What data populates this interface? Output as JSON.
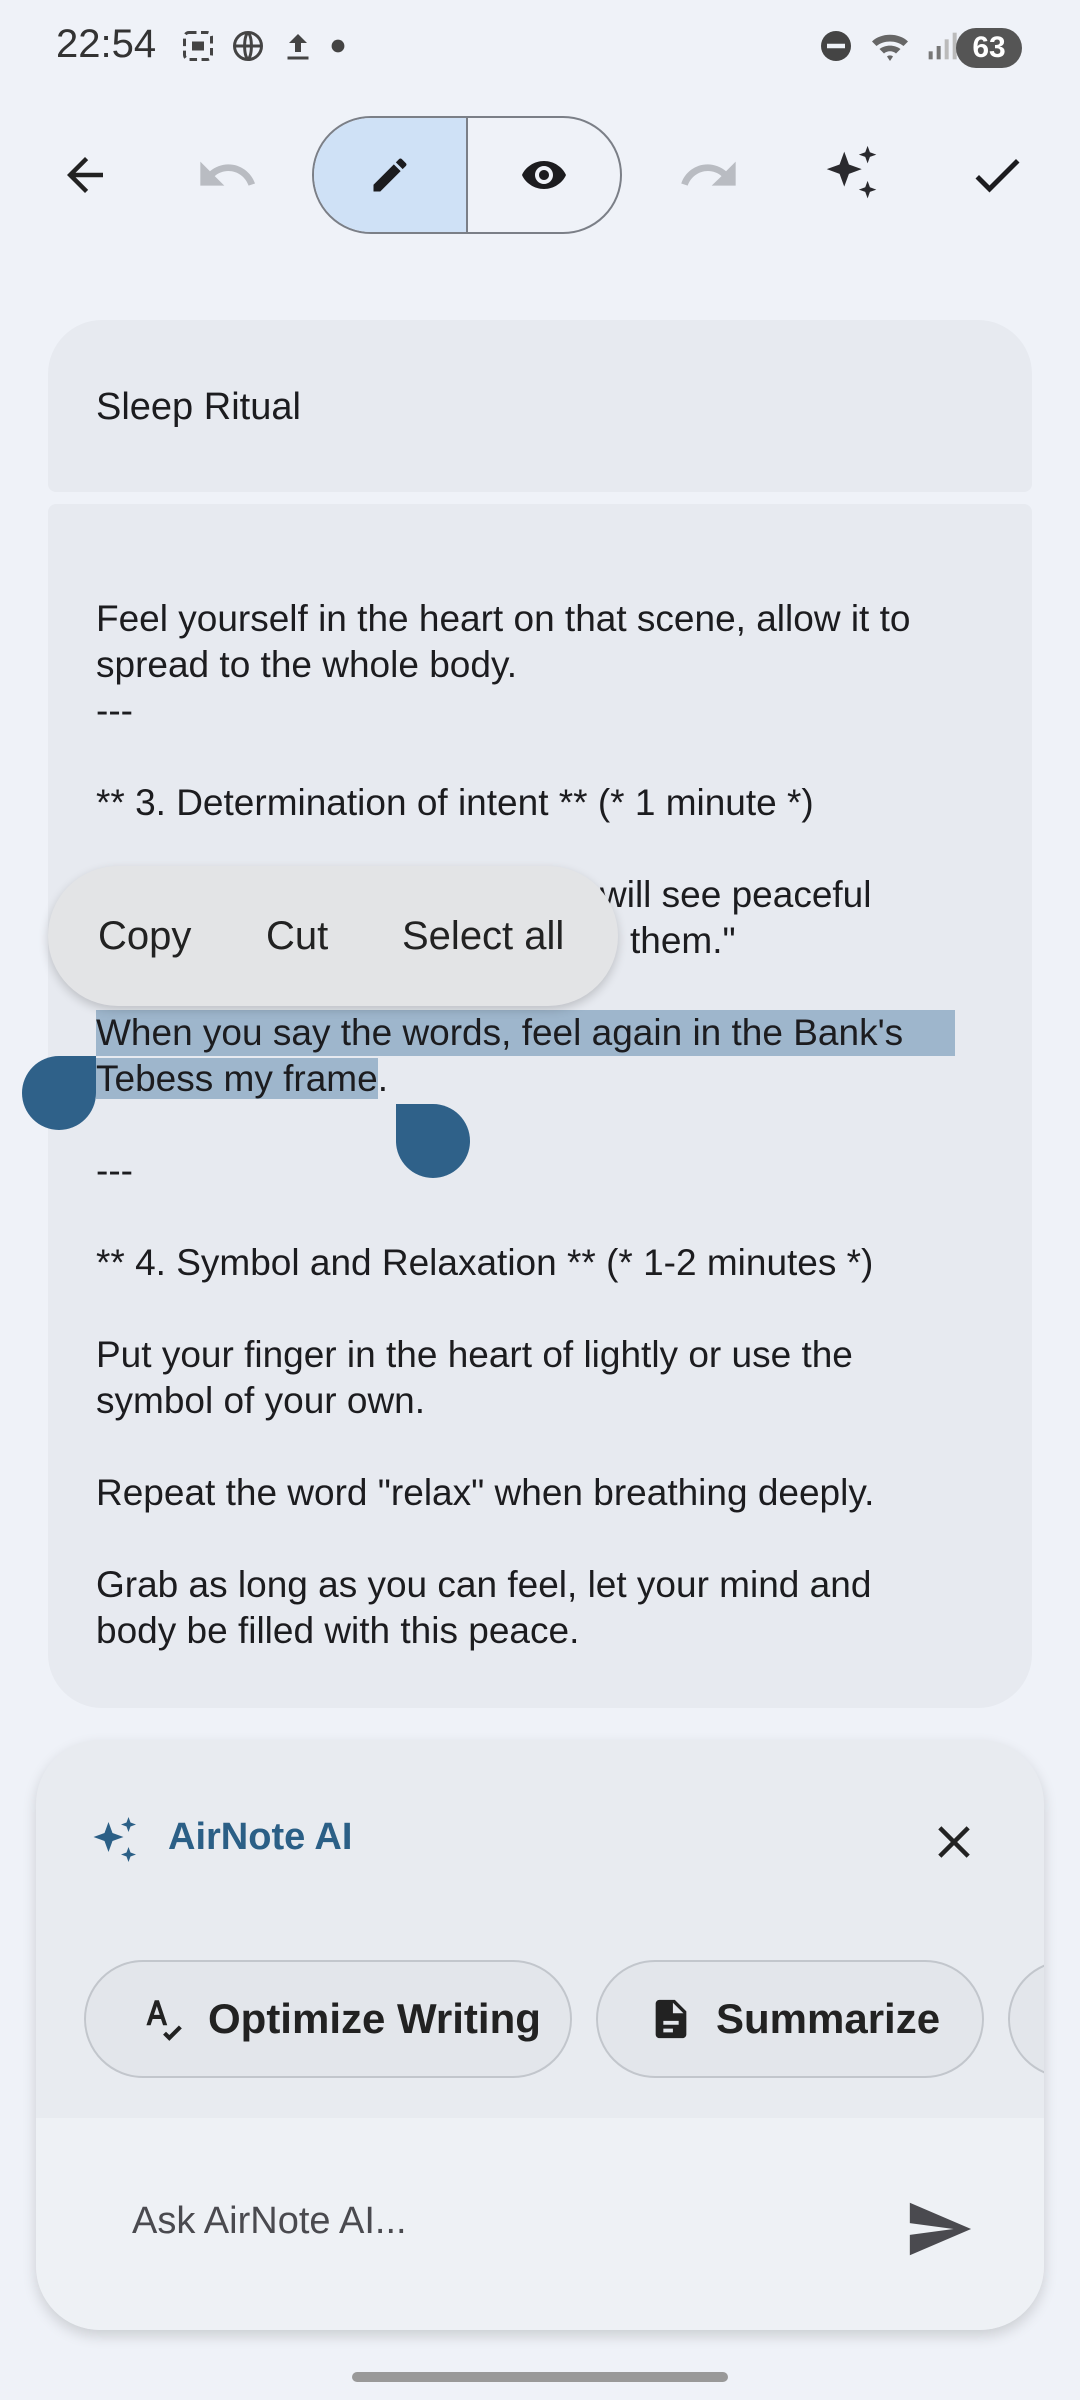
{
  "status_bar": {
    "time": "22:54",
    "battery": "63"
  },
  "toolbar": {
    "back": "back-arrow-icon",
    "undo": "undo-icon",
    "edit_mode": "pencil-icon",
    "preview_mode": "eye-icon",
    "redo": "redo-icon",
    "ai": "sparkle-icon",
    "done": "check-icon"
  },
  "note": {
    "title": "Sleep Ritual",
    "lines": [
      "Feel yourself in the heart on that scene, allow it to",
      "spread to the whole body.",
      "---",
      "** 3. Determination of intent ** (* 1 minute *)",
      "will see peaceful",
      "them.\"",
      "When you say the words, feel again in the Bank's",
      "Tebess my frame",
      ".",
      "---",
      "** 4. Symbol and Relaxation ** (* 1-2 minutes *)",
      "Put your finger in the heart of lightly or use the",
      "symbol of your own.",
      "Repeat the word \"relax\" when breathing deeply.",
      "Grab as long as you can feel, let your mind and",
      "body be filled with this peace."
    ]
  },
  "context_menu": {
    "copy": "Copy",
    "cut": "Cut",
    "select_all": "Select all"
  },
  "ai_panel": {
    "title": "AirNote AI",
    "chips": [
      {
        "label": "Optimize Writing",
        "icon": "spellcheck-icon"
      },
      {
        "label": "Summarize",
        "icon": "document-icon"
      }
    ],
    "input_placeholder": "Ask AirNote AI..."
  },
  "colors": {
    "accent": "#2b5f86",
    "selection": "#9eb6cc",
    "handle": "#2f6189"
  }
}
